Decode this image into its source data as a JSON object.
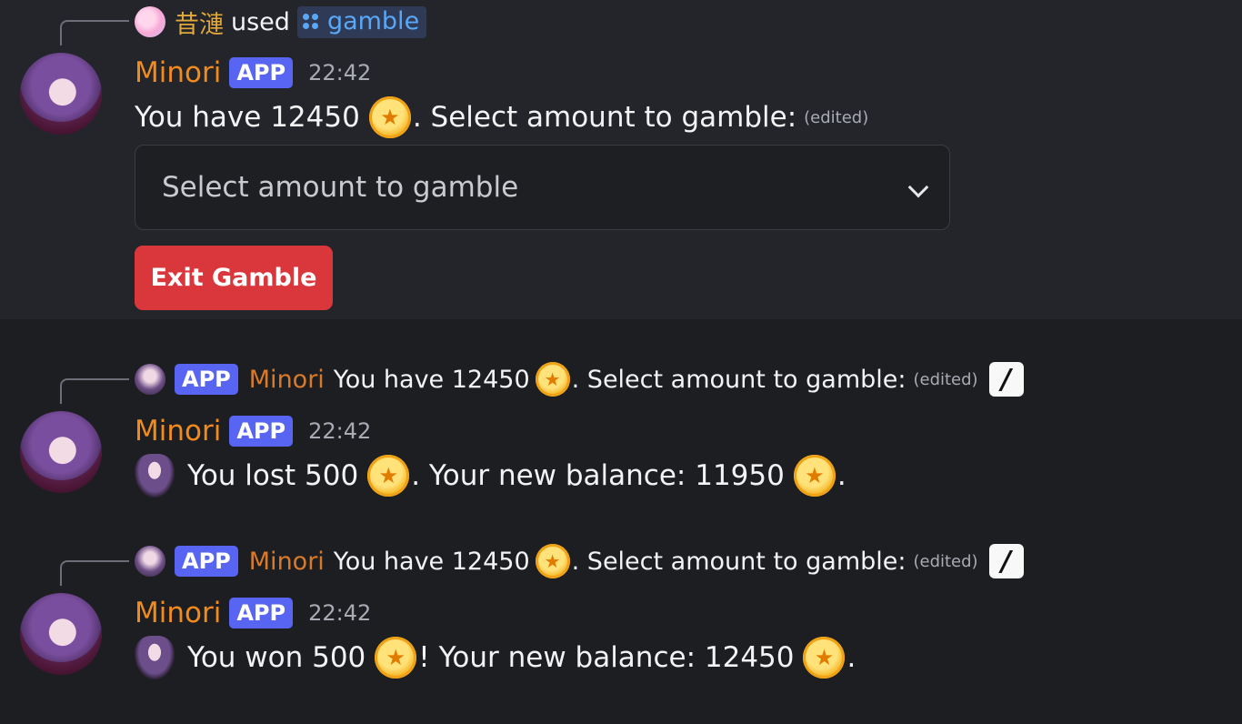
{
  "command_message": {
    "reply": {
      "user": "昔漣",
      "used_text": "used",
      "command": "gamble"
    },
    "author": "Minori",
    "badge": "APP",
    "time": "22:42",
    "content_prefix": "You have 12450",
    "content_suffix": ". Select amount to gamble:",
    "edited": "(edited)",
    "select_placeholder": "Select amount to gamble",
    "exit_button": "Exit Gamble"
  },
  "results": [
    {
      "reply": {
        "badge": "APP",
        "author": "Minori",
        "text_prefix": "You have 12450",
        "text_suffix": ". Select amount to gamble:",
        "edited": "(edited)"
      },
      "author": "Minori",
      "badge": "APP",
      "time": "22:42",
      "line": {
        "a": "You lost 500",
        "b": ". Your new balance: 11950",
        "c": "."
      }
    },
    {
      "reply": {
        "badge": "APP",
        "author": "Minori",
        "text_prefix": "You have 12450",
        "text_suffix": ". Select amount to gamble:",
        "edited": "(edited)"
      },
      "author": "Minori",
      "badge": "APP",
      "time": "22:42",
      "line": {
        "a": "You won 500",
        "b": "! Your new balance: 12450",
        "c": "."
      }
    }
  ],
  "icons": {
    "coin": "coin-star-icon",
    "slash": "slash-command-icon",
    "command": "app-command-icon",
    "chibi": "minori-chibi-icon",
    "chevron": "chevron-down-icon"
  },
  "colors": {
    "app_badge": "#5865f2",
    "author": "#f28b1e",
    "command_user": "#e1a83a",
    "command_link": "#5aa7f5",
    "danger_button": "#da373c",
    "background": "#1d1e22"
  }
}
